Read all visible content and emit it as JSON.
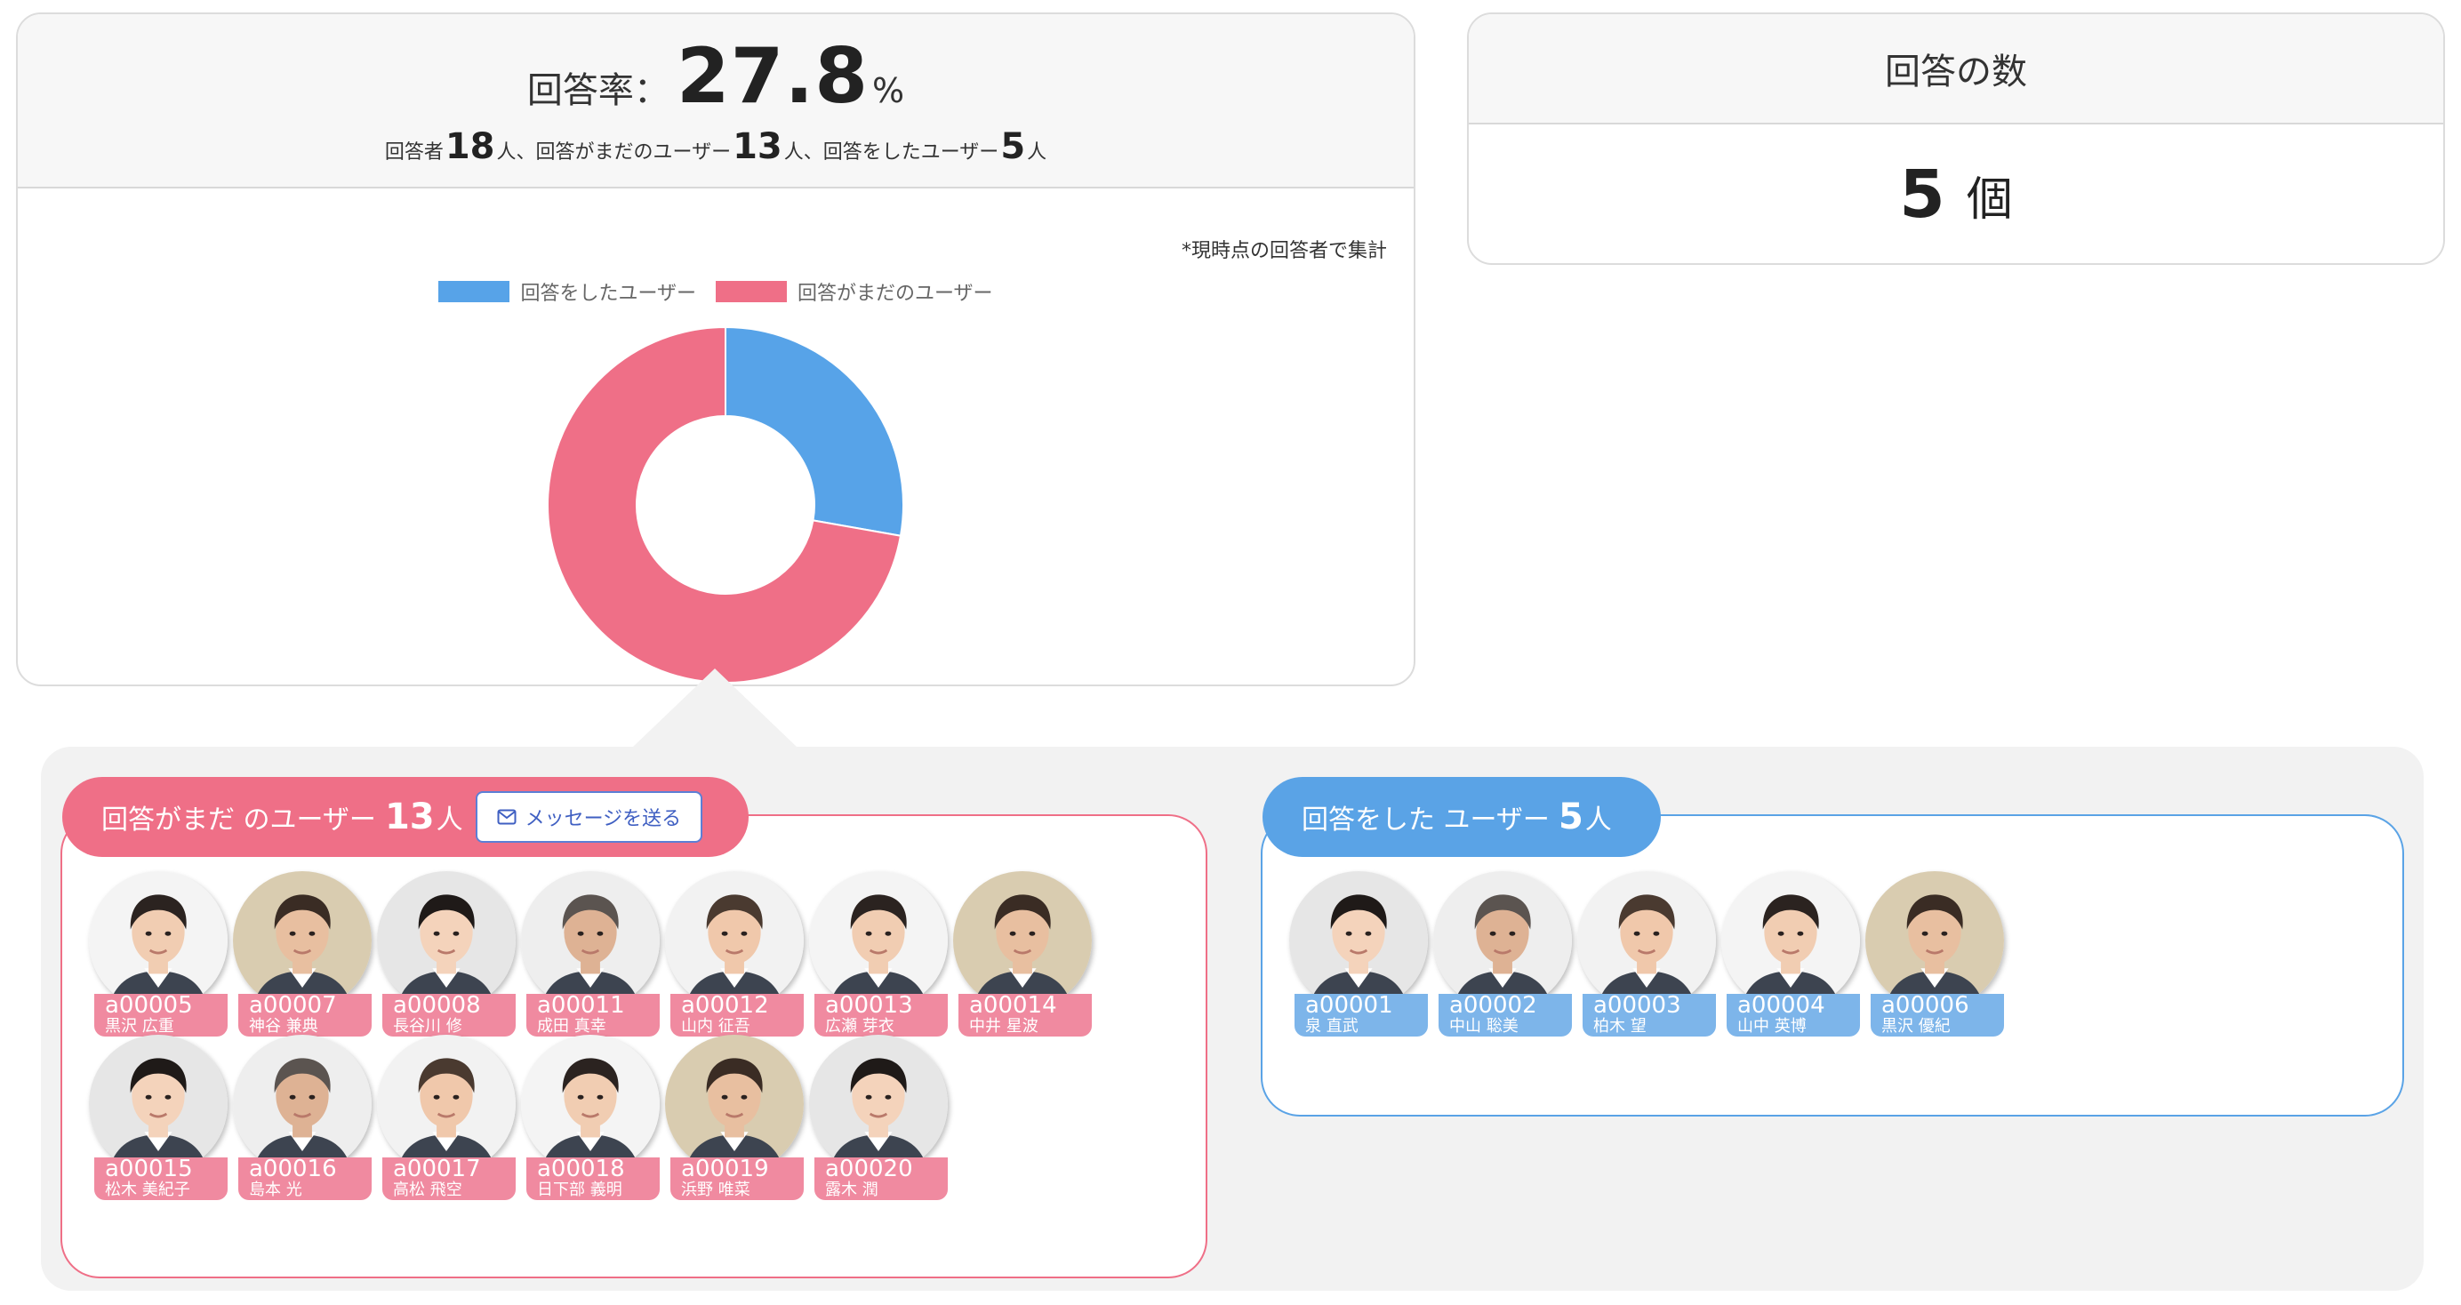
{
  "rate": {
    "label": "回答率：",
    "value": "27.8",
    "unit": "%",
    "sub": {
      "respondents_label": "回答者",
      "respondents": "18",
      "pending_label": "人、回答がまだのユーザー",
      "pending": "13",
      "answered_label": "人、回答をしたユーザー",
      "answered": "5",
      "unit": "人"
    }
  },
  "chart_note": "*現時点の回答者で集計",
  "colors": {
    "answered": "#57a3e8",
    "pending": "#ef6f87"
  },
  "chart_data": {
    "type": "pie",
    "categories": [
      "回答をしたユーザー",
      "回答がまだのユーザー"
    ],
    "values": [
      5,
      13
    ],
    "donut": true,
    "legend": "top"
  },
  "count": {
    "title": "回答の数",
    "value": "5",
    "unit": "個"
  },
  "pending_group": {
    "label": "回答がまだ のユーザー",
    "count": "13",
    "unit": "人",
    "button_label": "メッセージを送る",
    "users": [
      {
        "id": "a00005",
        "name": "黒沢 広重"
      },
      {
        "id": "a00007",
        "name": "神谷 兼典"
      },
      {
        "id": "a00008",
        "name": "長谷川 修"
      },
      {
        "id": "a00011",
        "name": "成田 真幸"
      },
      {
        "id": "a00012",
        "name": "山内 征吾"
      },
      {
        "id": "a00013",
        "name": "広瀬 芽衣"
      },
      {
        "id": "a00014",
        "name": "中井 星波"
      },
      {
        "id": "a00015",
        "name": "松木 美紀子"
      },
      {
        "id": "a00016",
        "name": "島本 光"
      },
      {
        "id": "a00017",
        "name": "高松 飛空"
      },
      {
        "id": "a00018",
        "name": "日下部 義明"
      },
      {
        "id": "a00019",
        "name": "浜野 唯菜"
      },
      {
        "id": "a00020",
        "name": "露木 潤"
      }
    ]
  },
  "answered_group": {
    "label": "回答をした ユーザー",
    "count": "5",
    "unit": "人",
    "users": [
      {
        "id": "a00001",
        "name": "泉 直武"
      },
      {
        "id": "a00002",
        "name": "中山 聡美"
      },
      {
        "id": "a00003",
        "name": "柏木 望"
      },
      {
        "id": "a00004",
        "name": "山中 英博"
      },
      {
        "id": "a00006",
        "name": "黒沢 優紀"
      }
    ]
  }
}
